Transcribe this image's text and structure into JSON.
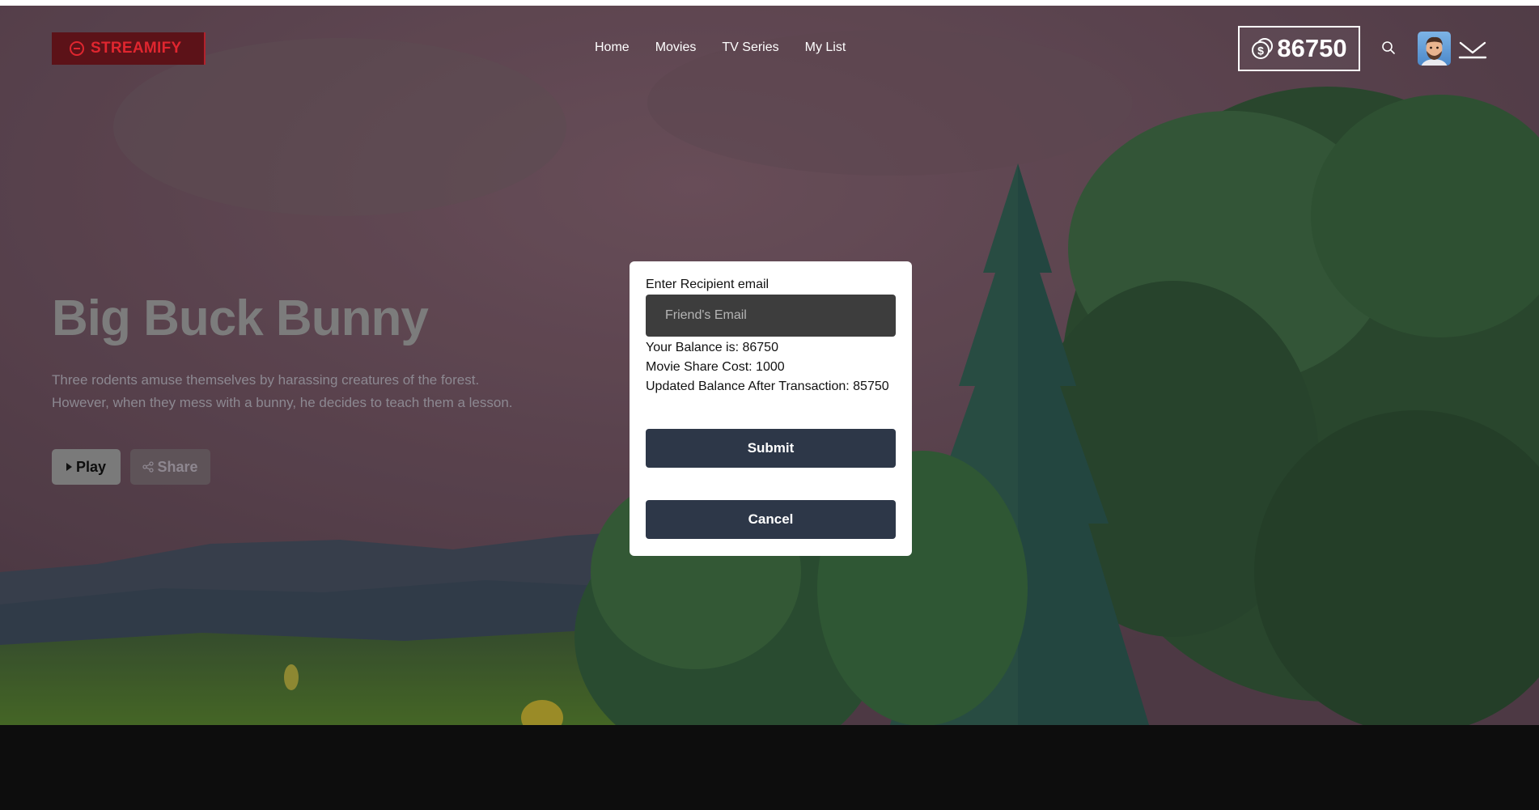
{
  "app": {
    "name": "STREAMIFY"
  },
  "nav": {
    "links": [
      "Home",
      "Movies",
      "TV Series",
      "My List"
    ]
  },
  "header": {
    "balance": "86750"
  },
  "hero": {
    "title": "Big Buck Bunny",
    "description": "Three rodents amuse themselves by harassing creatures of the forest. However, when they mess with a bunny, he decides to teach them a lesson.",
    "play_label": "Play",
    "share_label": "Share"
  },
  "modal": {
    "label": "Enter Recipient email",
    "email_placeholder": "Friend's Email",
    "email_value": "",
    "balance_line": "Your Balance is: 86750",
    "cost_line": "Movie Share Cost: 1000",
    "updated_line": "Updated Balance After Transaction: 85750",
    "submit_label": "Submit",
    "cancel_label": "Cancel"
  },
  "colors": {
    "brand_red": "#e0262f",
    "button_dark": "#2d3748"
  }
}
